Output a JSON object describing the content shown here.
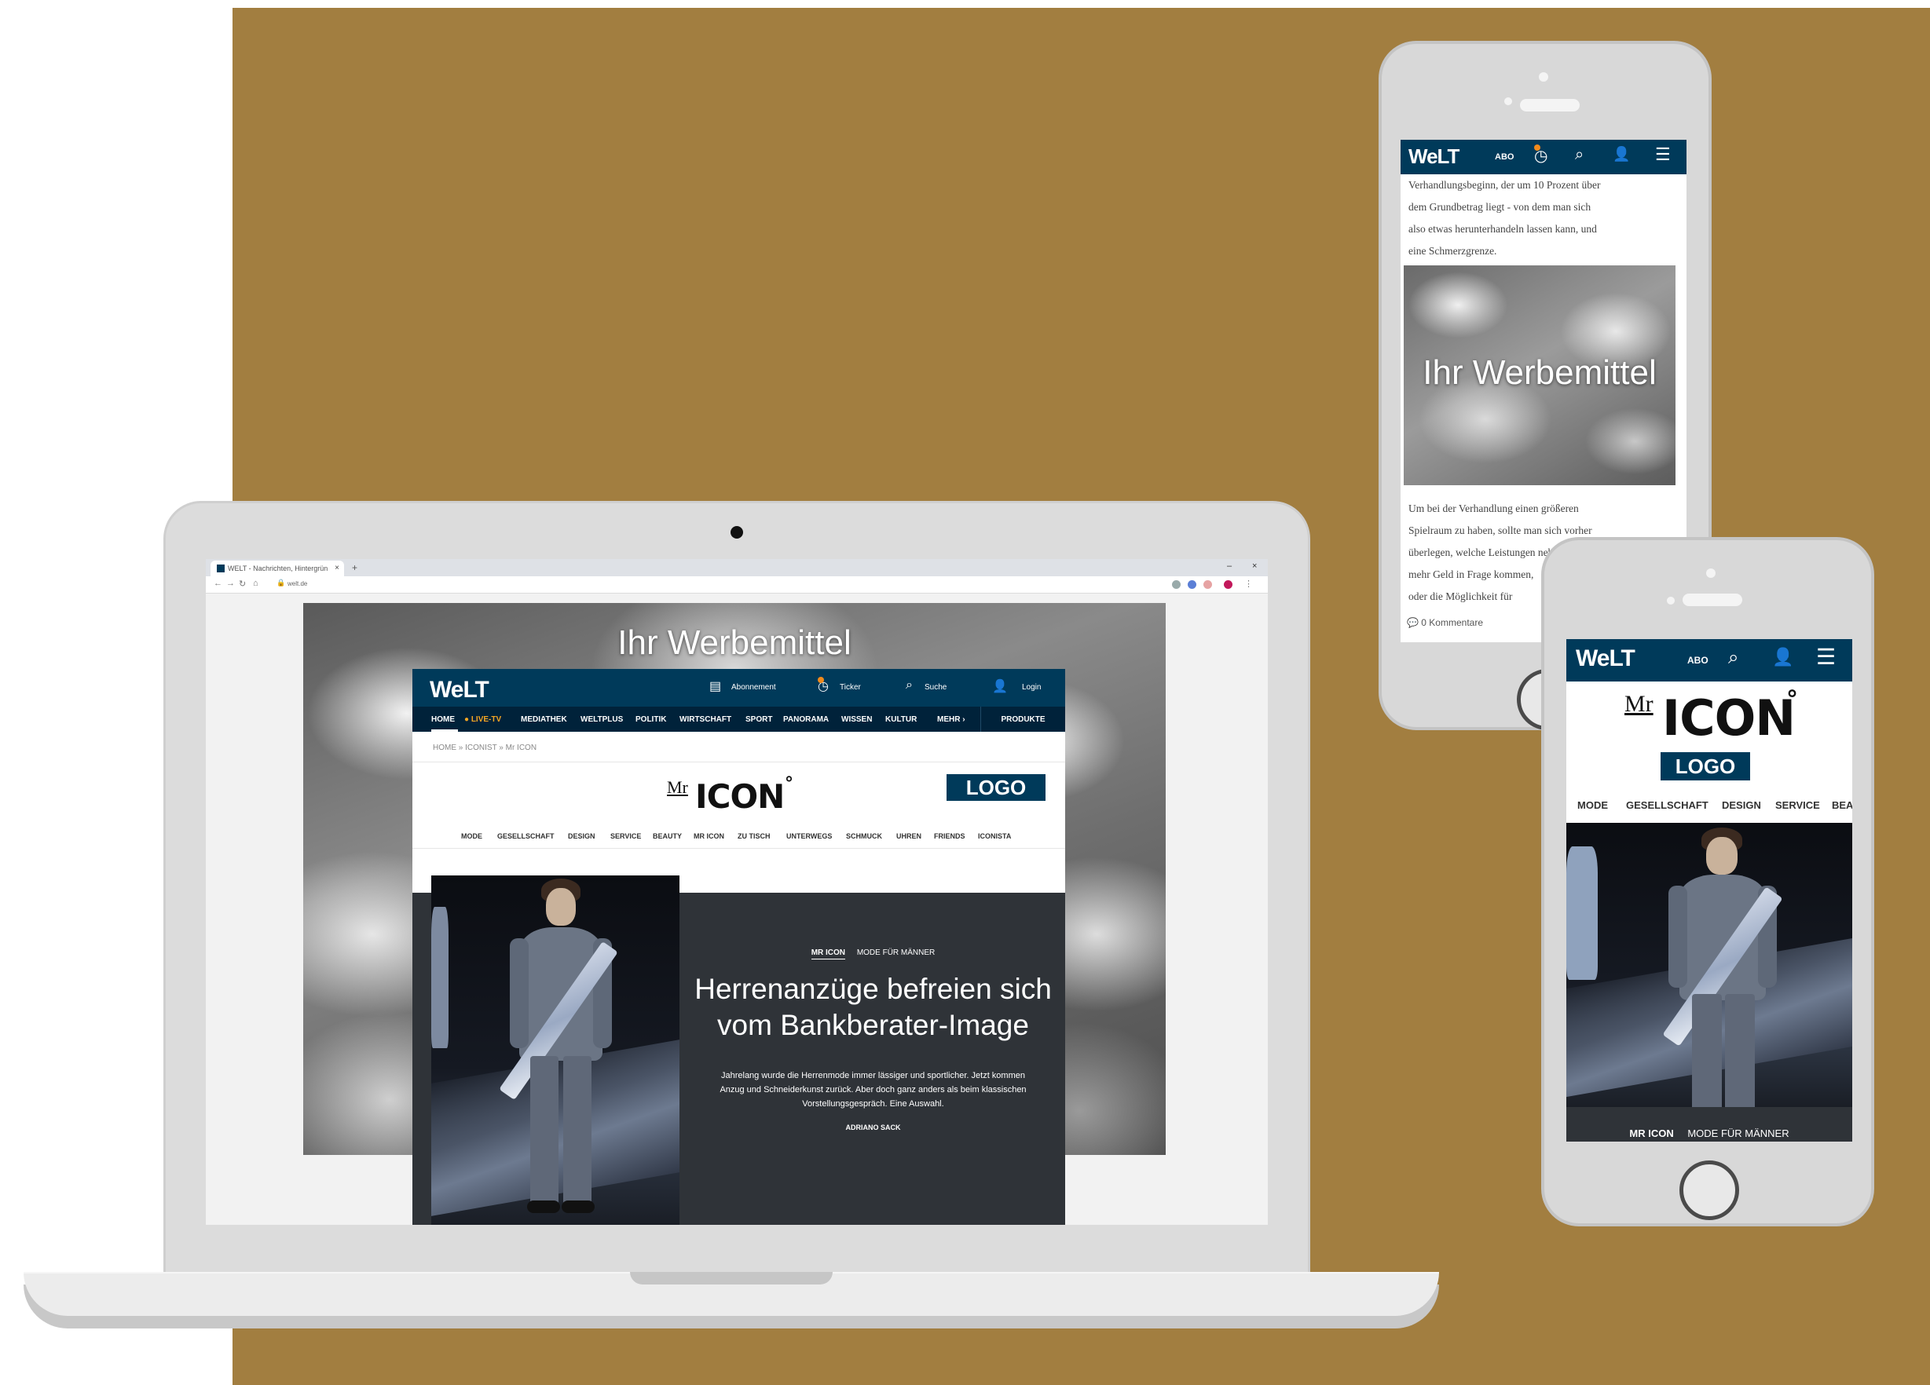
{
  "colors": {
    "background_gold": "#a27e40",
    "welt_blue": "#003a5a",
    "teaser_dark": "#2f3338",
    "ticker_orange": "#f08a1c"
  },
  "browser": {
    "tab_title": "WELT - Nachrichten, Hintergrün",
    "tab_close": "×",
    "new_tab": "+",
    "url_text": "welt.de",
    "win_controls": [
      "‒",
      "×"
    ],
    "nav_icons": [
      "back-arrow-icon",
      "forward-arrow-icon",
      "reload-icon",
      "home-icon"
    ]
  },
  "ad": {
    "label": "Ihr Werbemittel"
  },
  "welt": {
    "logo": "WeLT",
    "header": {
      "abo": "Abonnement",
      "ticker": "Ticker",
      "search": "Suche",
      "login": "Login"
    },
    "nav": [
      "HOME",
      "LIVE-TV",
      "MEDIATHEK",
      "WELTPLUS",
      "POLITIK",
      "WIRTSCHAFT",
      "SPORT",
      "PANORAMA",
      "WISSEN",
      "KULTUR",
      "MEHR"
    ],
    "mehr_chevron": "›",
    "produkte": "PRODUKTE",
    "breadcrumb": "HOME  »  ICONIST  »  Mr ICON"
  },
  "mricon": {
    "mr": "Mr",
    "icon": "ICON",
    "degree": "°",
    "logo_box": "LOGO"
  },
  "subnav": [
    "MODE",
    "GESELLSCHAFT",
    "DESIGN",
    "SERVICE",
    "BEAUTY",
    "MR ICON",
    "ZU TISCH",
    "UNTERWEGS",
    "SCHMUCK",
    "UHREN",
    "FRIENDS",
    "ICONISTA"
  ],
  "teaser": {
    "kicker_primary": "MR ICON",
    "kicker_secondary": "MODE FÜR MÄNNER",
    "headline": "Herrenanzüge befreien sich vom Bankberater-Image",
    "body": "Jahrelang wurde die Herrenmode immer lässiger und sportlicher. Jetzt kommen Anzug und Schneiderkunst zurück. Aber doch ganz anders als beim klassischen Vorstellungsgespräch. Eine Auswahl.",
    "author": "ADRIANO SACK"
  },
  "phone_article": {
    "abo": "ABO",
    "text_top": [
      "Verhandlungsbeginn, der um 10 Prozent über",
      "dem Grundbetrag liegt - von dem man sich",
      "also etwas herunterhandeln lassen kann, und",
      "eine Schmerzgrenze."
    ],
    "text_bottom": [
      "Um bei der Verhandlung einen größeren",
      "Spielraum zu haben, sollte man sich vorher",
      "überlegen, welche Leistungen neben",
      "mehr Geld in Frage kommen,",
      "oder die Möglichkeit für"
    ],
    "comments": "0 Kommentare"
  },
  "phone_small": {
    "abo": "ABO",
    "subnav": [
      "MODE",
      "GESELLSCHAFT",
      "DESIGN",
      "SERVICE",
      "BEA"
    ],
    "kicker_primary": "MR ICON",
    "kicker_secondary": "MODE FÜR MÄNNER"
  }
}
